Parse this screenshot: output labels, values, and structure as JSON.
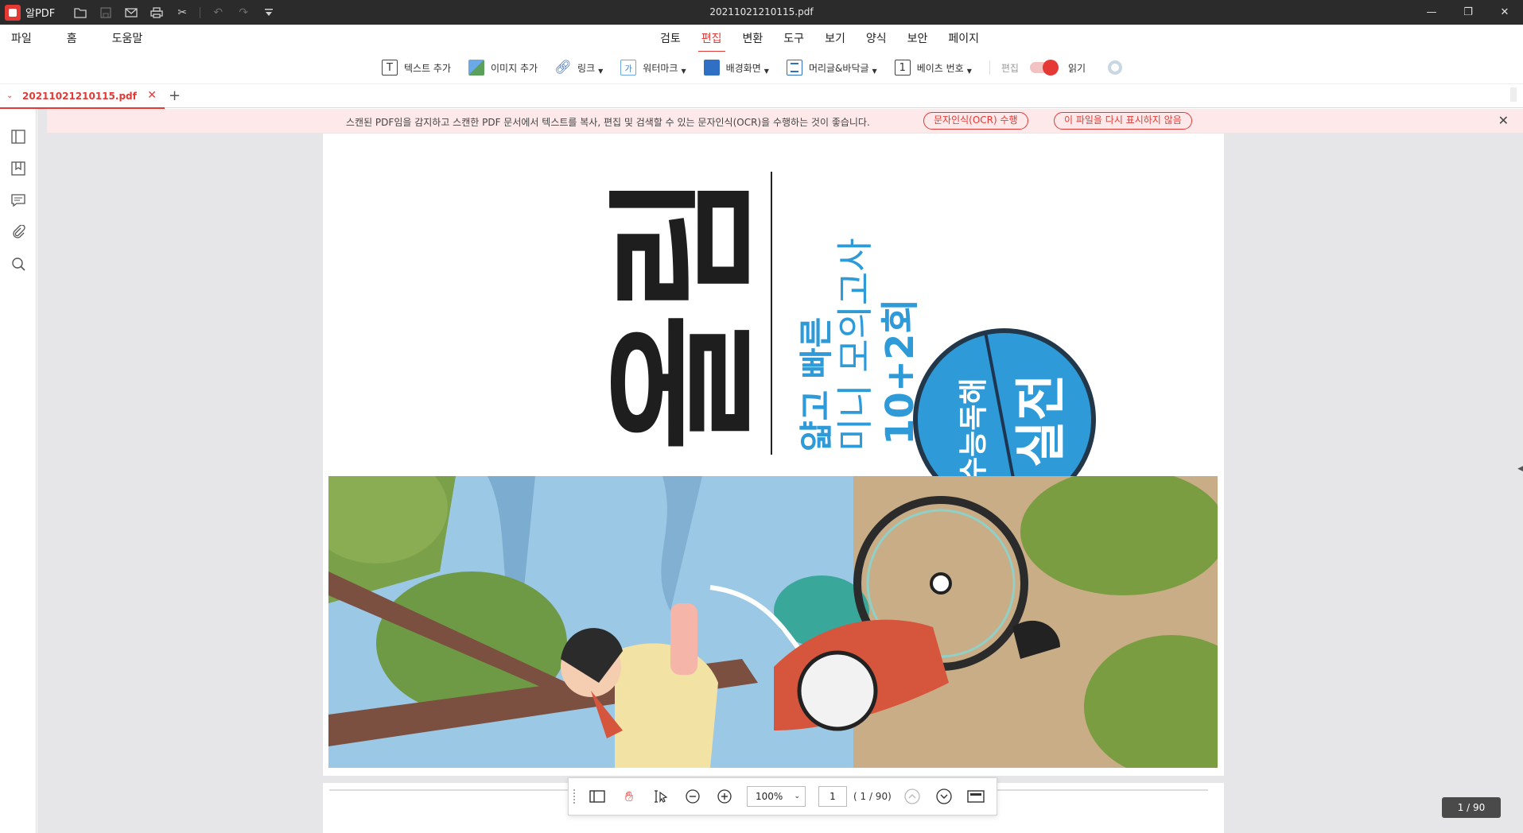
{
  "app": {
    "name": "알PDF",
    "window_title": "20211021210115.pdf"
  },
  "titlebar": {
    "icons": [
      "open-folder-icon",
      "save-icon",
      "mail-icon",
      "print-icon",
      "scissors-icon",
      "undo-icon",
      "redo-icon",
      "dropdown-icon"
    ],
    "window_controls": {
      "minimize": "—",
      "restore": "❐",
      "close": "✕"
    }
  },
  "menu": {
    "left": [
      "파일",
      "홈",
      "도움말"
    ],
    "center": [
      "검토",
      "편집",
      "변환",
      "도구",
      "보기",
      "양식",
      "보안",
      "페이지"
    ],
    "active": "편집"
  },
  "toolbar": {
    "add_text": "텍스트 추가",
    "add_image": "이미지 추가",
    "link": "링크",
    "watermark": "워터마크",
    "watermark_glyph": "가",
    "background": "배경화면",
    "header_footer": "머리글&바닥글",
    "bates": "베이츠 번호",
    "bates_glyph": "1",
    "mode_edit": "편집",
    "mode_read": "읽기"
  },
  "tab": {
    "filename": "20211021210115.pdf"
  },
  "notice": {
    "text": "스캔된 PDF임을 감지하고 스캔한 PDF 문서에서 텍스트를 복사, 편집 및 검색할 수 있는 문자인식(OCR)을 수행하는 것이 좋습니다.",
    "ocr_button": "문자인식(OCR) 수행",
    "dismiss_button": "이 파일을 다시 표시하지 않음"
  },
  "cover": {
    "brand": "올림",
    "line1": "얇고 빠른",
    "line2": "미니 모의고사",
    "line3": "10+2회",
    "stamp_top": "수능독해",
    "stamp_bottom": "실전"
  },
  "status": {
    "page_badge": "1 / 90"
  },
  "bottom_bar": {
    "zoom": "100%",
    "page_input": "1",
    "page_total": "( 1 / 90)"
  },
  "colors": {
    "accent": "#e53935",
    "titlebar": "#2b2b2b",
    "stamp_blue": "#2e9ad8"
  }
}
